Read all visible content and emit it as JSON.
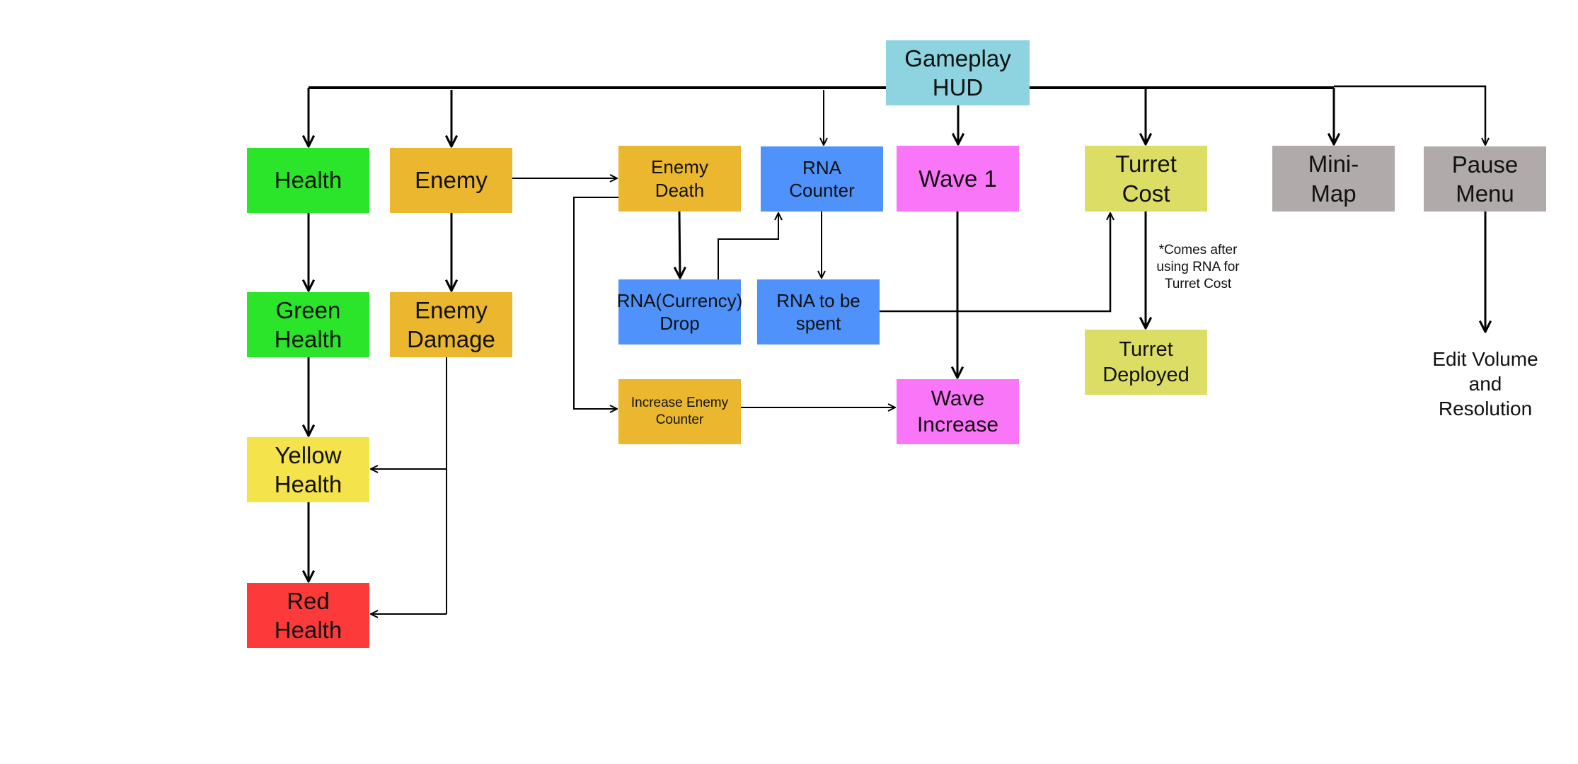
{
  "colors": {
    "hud": "#8dd3e0",
    "health": "#2ae52a",
    "enemy": "#ebb72e",
    "rna": "#4f92fc",
    "wave": "#fa76f8",
    "turret": "#dcdd64",
    "menu": "#b0aaaa",
    "yellow_health": "#f4e34a",
    "red_health": "#fd3a3a"
  },
  "nodes": {
    "hud": "Gameplay\nHUD",
    "health": "Health",
    "enemy": "Enemy",
    "enemy_death": "Enemy\nDeath",
    "rna_counter": "RNA\nCounter",
    "wave1": "Wave 1",
    "turret_cost": "Turret\nCost",
    "mini_map": "Mini-\nMap",
    "pause_menu": "Pause\nMenu",
    "green_health": "Green\nHealth",
    "enemy_damage": "Enemy\nDamage",
    "rna_drop": "RNA(Currency)\nDrop",
    "rna_spent": "RNA to be\nspent",
    "increase_enemy_counter": "Increase Enemy\nCounter",
    "wave_increase": "Wave\nIncrease",
    "turret_deployed": "Turret\nDeployed",
    "yellow_health": "Yellow\nHealth",
    "red_health": "Red\nHealth",
    "edit_volume": "Edit Volume\nand\nResolution"
  },
  "notes": {
    "turret_note": "*Comes after\nusing RNA for\nTurret Cost"
  }
}
